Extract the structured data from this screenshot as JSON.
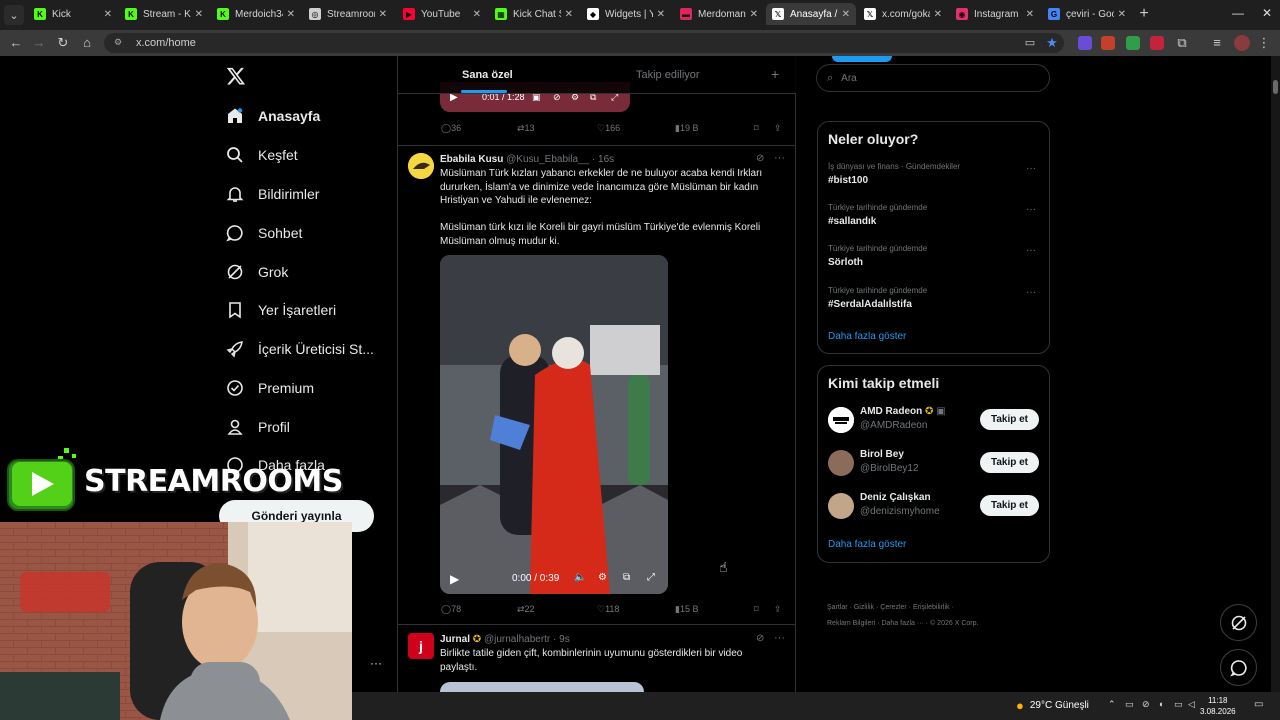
{
  "browser": {
    "tabs": [
      {
        "label": "Kick",
        "color": "#53fc18",
        "glyph": "K"
      },
      {
        "label": "Stream - Kick",
        "color": "#53fc18",
        "glyph": "K"
      },
      {
        "label": "Merdoich34",
        "color": "#53fc18",
        "glyph": "K"
      },
      {
        "label": "Streamrooms",
        "color": "#cfcfcf",
        "glyph": "◎"
      },
      {
        "label": "YouTube",
        "color": "#ff0033",
        "glyph": "▶"
      },
      {
        "label": "Kick Chat Se",
        "color": "#53fc18",
        "glyph": "▦"
      },
      {
        "label": "Widgets | Yo",
        "color": "#ffffff",
        "glyph": "◆"
      },
      {
        "label": "Merdoman",
        "color": "#e0245e",
        "glyph": "▬"
      },
      {
        "label": "Anasayfa / X",
        "color": "#ffffff",
        "glyph": "𝕏",
        "active": true
      },
      {
        "label": "x.com/gokal",
        "color": "#ffffff",
        "glyph": "𝕏"
      },
      {
        "label": "Instagram",
        "color": "#e1306c",
        "glyph": "◉"
      },
      {
        "label": "çeviri - Goog",
        "color": "#4285f4",
        "glyph": "G"
      }
    ],
    "url": "x.com/home"
  },
  "nav": {
    "items": [
      {
        "label": "Anasayfa",
        "icon": "home-icon"
      },
      {
        "label": "Keşfet",
        "icon": "search-icon"
      },
      {
        "label": "Bildirimler",
        "icon": "bell-icon"
      },
      {
        "label": "Sohbet",
        "icon": "chat-icon"
      },
      {
        "label": "Grok",
        "icon": "grok-icon"
      },
      {
        "label": "Yer İşaretleri",
        "icon": "bookmark-icon"
      },
      {
        "label": "İçerik Üreticisi St...",
        "icon": "rocket-icon"
      },
      {
        "label": "Premium",
        "icon": "verified-icon"
      },
      {
        "label": "Profil",
        "icon": "person-icon"
      },
      {
        "label": "Daha fazla",
        "icon": "more-icon"
      }
    ],
    "post_label": "Gönderi yayınla"
  },
  "overlay": {
    "brand": "STREAMROOMS"
  },
  "feed": {
    "tabs": [
      "Sana özel",
      "Takip ediliyor"
    ],
    "prev_video_time": "0:01 / 1:28",
    "prev_actions": {
      "replies": "36",
      "reposts": "13",
      "likes": "166",
      "views": "19 B"
    },
    "tweets": [
      {
        "name": "Ebabila Kusu",
        "handle": "@Kusu_Ebabila__",
        "time": "· 16s",
        "text1": "Müslüman Türk kızları yabancı erkekler de ne buluyor acaba kendi Irkları dururken, İslam'a ve dinimize vede İnancımıza göre Müslüman bir kadın Hristiyan ve Yahudi ile evlenemez:",
        "text2": "Müslüman türk kızı ile Koreli bir gayri müslüm Türkiye'de evlenmiş Koreli Müslüman olmuş mudur ki.",
        "video_time": "0:00 / 0:39",
        "actions": {
          "replies": "78",
          "reposts": "22",
          "likes": "118",
          "views": "15 B"
        }
      },
      {
        "name": "Jurnal",
        "handle": "@jurnalhabertr",
        "time": "· 9s",
        "text1": "Birlikte tatile giden çift, kombinlerinin uyumunu gösterdikleri bir video paylaştı."
      }
    ]
  },
  "right": {
    "search_placeholder": "Ara",
    "trends_title": "Neler oluyor?",
    "trends": [
      {
        "meta": "İş dünyası ve finans · Gündemdekiler",
        "name": "#bist100"
      },
      {
        "meta": "Türkiye tarihinde gündemde",
        "name": "#sallandık"
      },
      {
        "meta": "Türkiye tarihinde gündemde",
        "name": "Sörloth"
      },
      {
        "meta": "Türkiye tarihinde gündemde",
        "name": "#SerdalAdalıİstifa"
      }
    ],
    "show_more": "Daha fazla göster",
    "who_title": "Kimi takip etmeli",
    "who": [
      {
        "name": "AMD Radeon",
        "handle": "@AMDRadeon"
      },
      {
        "name": "Birol Bey",
        "handle": "@BirolBey12"
      },
      {
        "name": "Deniz Çalışkan",
        "handle": "@denizismyhome"
      }
    ],
    "follow_label": "Takip et",
    "footer1": "Şartlar  ·  Gizlilik  ·  Çerezler  ·  Erişilebilirlik  ·",
    "footer2": "Reklam Bilgileri  ·  Daha fazla ···  ·  © 2026 X Corp."
  },
  "taskbar": {
    "weather": "29°C  Güneşli",
    "time": "11:18",
    "date": "3.08.2026"
  }
}
